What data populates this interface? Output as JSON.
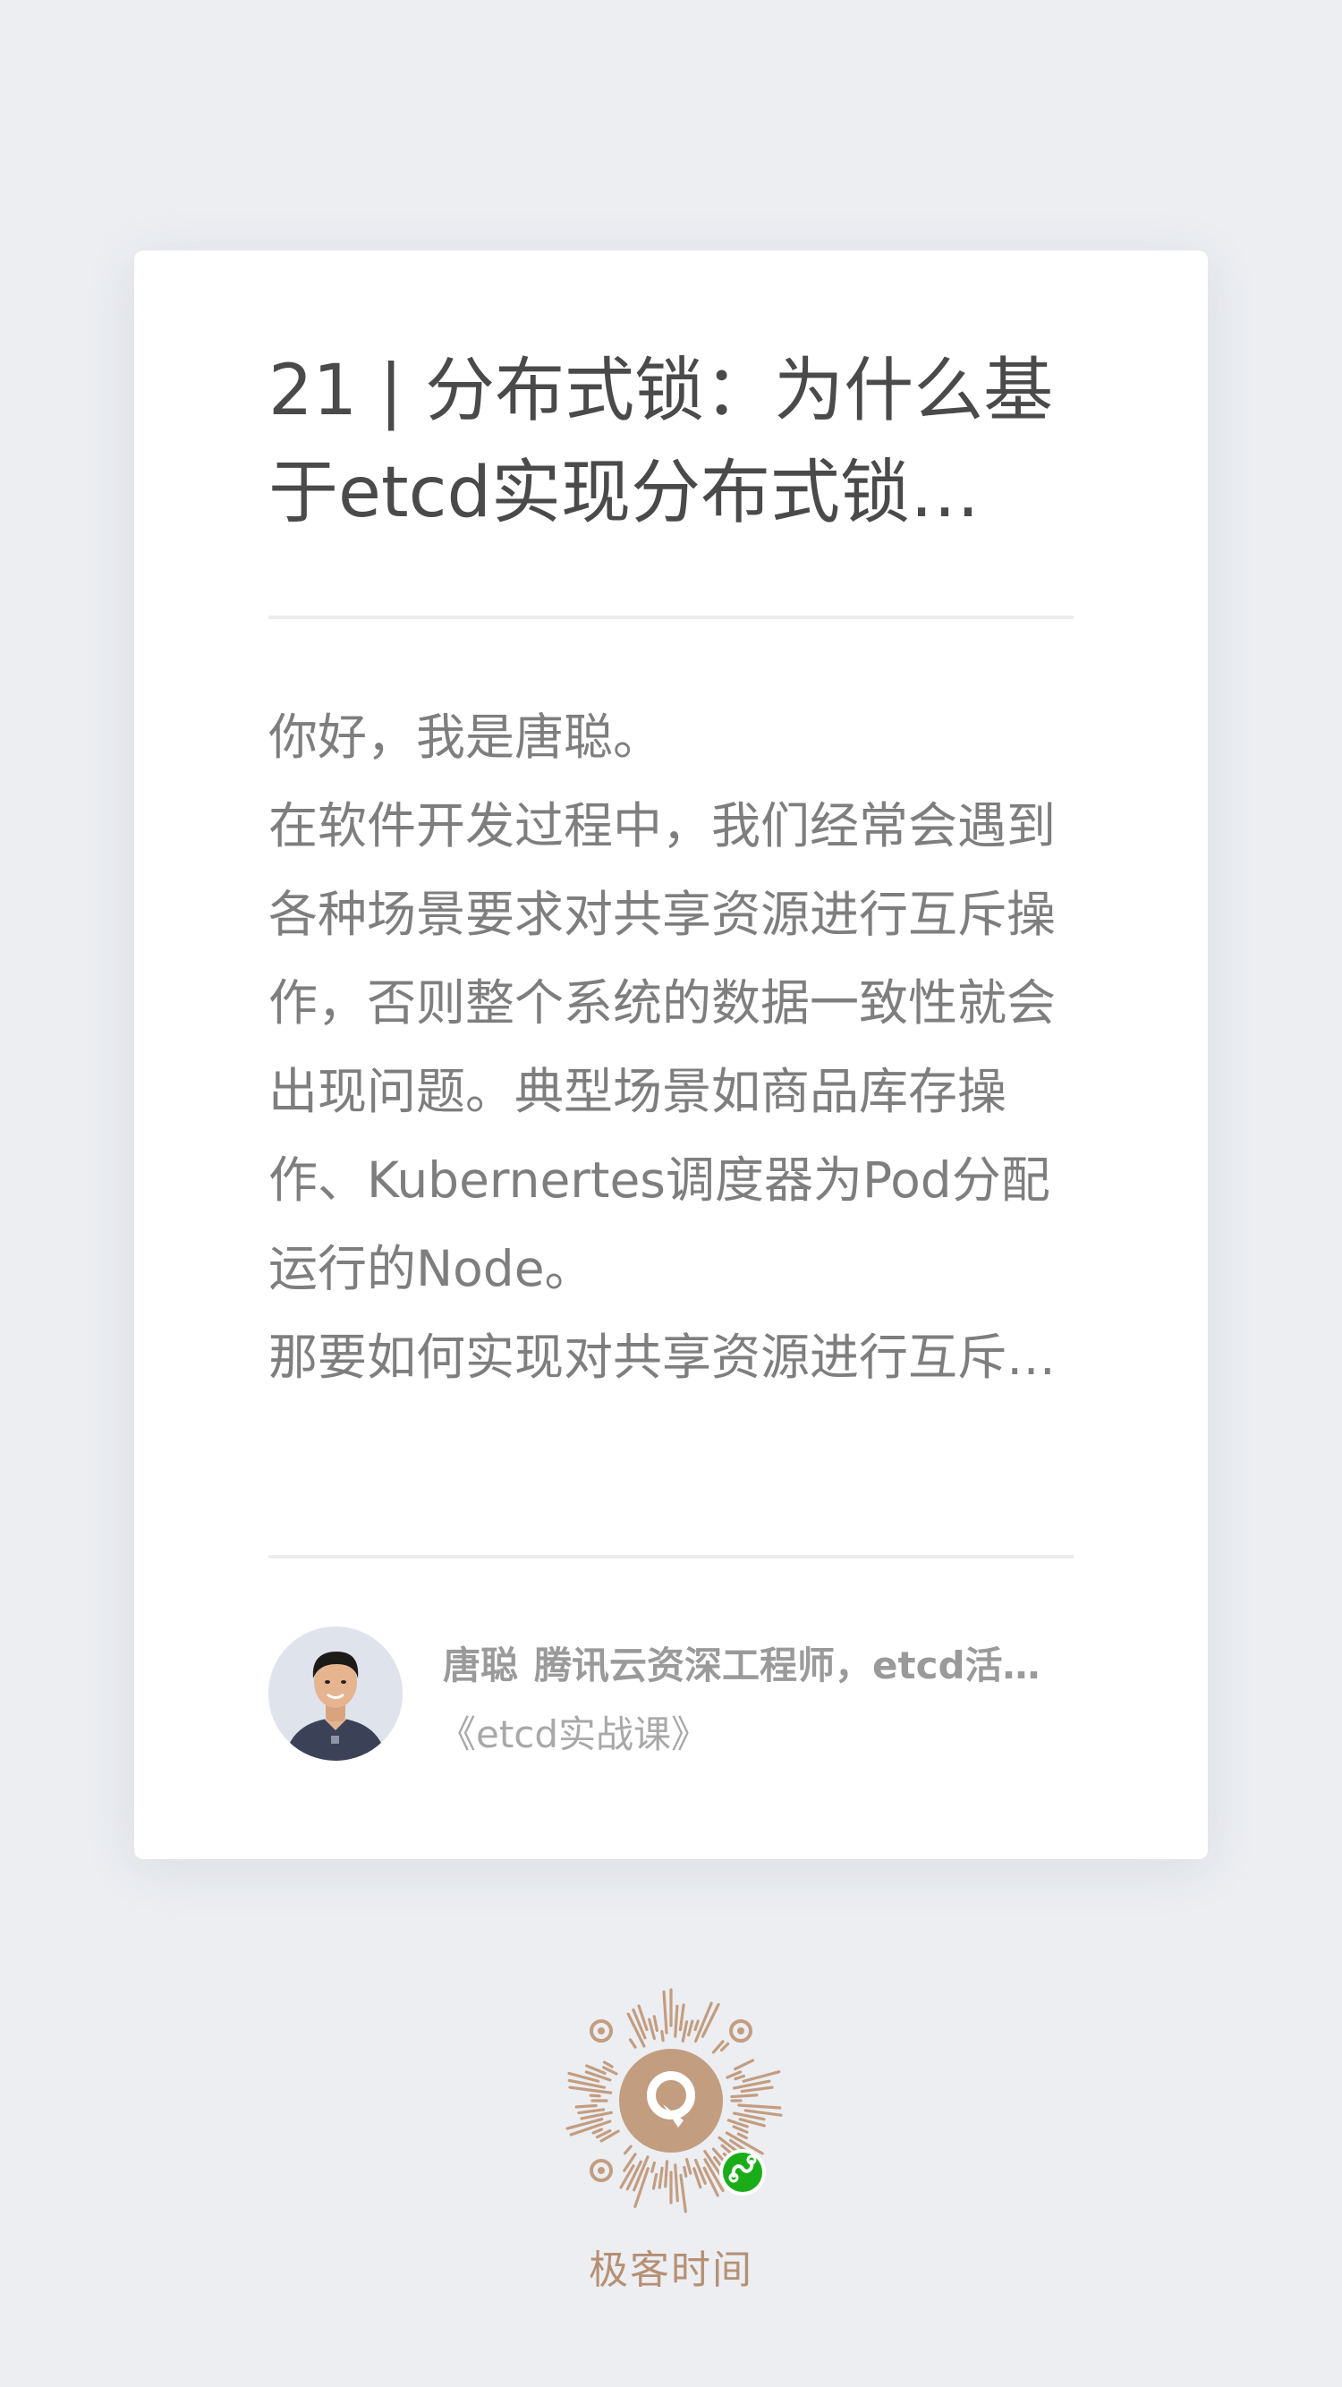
{
  "article": {
    "title_lines": [
      "21 | 分布式锁：为什么基",
      "于etcd实现分布式锁…"
    ],
    "excerpt_lines": [
      "你好，我是唐聪。",
      "在软件开发过程中，我们经常会遇到",
      "各种场景要求对共享资源进行互斥操",
      "作，否则整个系统的数据一致性就会",
      "出现问题。典型场景如商品库存操",
      "作、Kubernertes调度器为Pod分配",
      "运行的Node。",
      "那要如何实现对共享资源进行互斥…"
    ]
  },
  "author": {
    "name": "唐聪",
    "bio": "腾讯云资深工程师，etcd活…",
    "course": "《etcd实战课》",
    "avatar_icon": "author-avatar-photo"
  },
  "footer": {
    "qr_icon": "mini-program-qr-code",
    "brand": "极客时间"
  },
  "colors": {
    "background": "#eceef2",
    "card": "#ffffff",
    "title_text": "#4a4a4a",
    "body_text": "#7e7e7e",
    "brand_accent": "#b69074",
    "wechat_green": "#1aad19"
  }
}
